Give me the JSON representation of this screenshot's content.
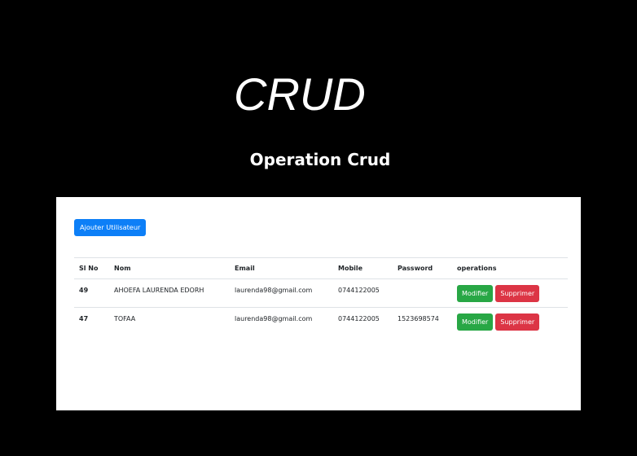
{
  "header": {
    "logo_text": "CRUD",
    "subtitle": "Operation Crud"
  },
  "toolbar": {
    "add_user_label": "Ajouter Utilisateur"
  },
  "colors": {
    "background": "#000000",
    "panel": "#ffffff",
    "primary": "#0d7ff7",
    "success": "#28a745",
    "danger": "#dc3545"
  },
  "table": {
    "columns": [
      "Sl No",
      "Nom",
      "Email",
      "Mobile",
      "Password",
      "operations"
    ],
    "rows": [
      {
        "slno": "49",
        "nom": "AHOEFA LAURENDA EDORH",
        "email": "laurenda98@gmail.com",
        "mobile": "0744122005",
        "password": "",
        "modify_label": "Modifier",
        "delete_label": "Supprimer"
      },
      {
        "slno": "47",
        "nom": "TOFAA",
        "email": "laurenda98@gmail.com",
        "mobile": "0744122005",
        "password": "1523698574",
        "modify_label": "Modifier",
        "delete_label": "Supprimer"
      }
    ]
  }
}
